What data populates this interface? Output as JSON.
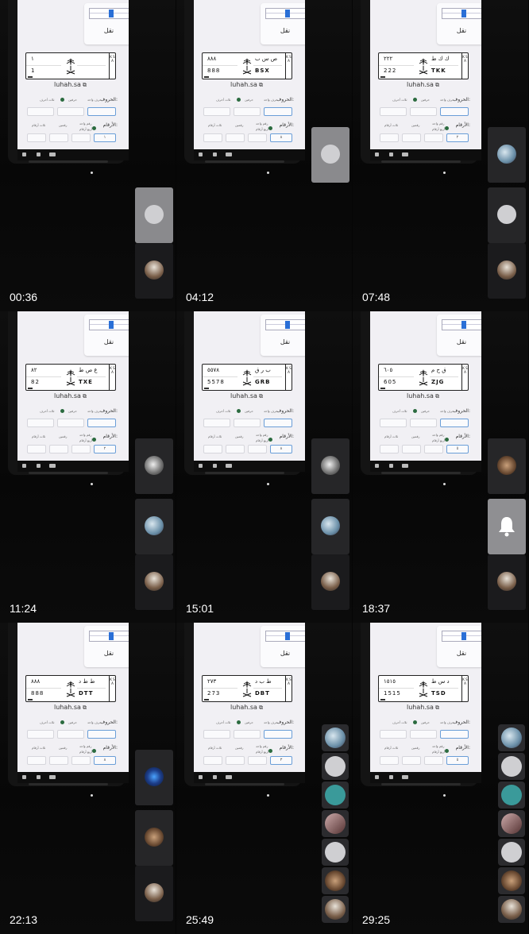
{
  "frames": [
    {
      "timestamp": "00:36",
      "plate": {
        "ar_num": "١",
        "en_num": "1",
        "ar_let": "",
        "en_let": ""
      },
      "numbers_input": "١",
      "tiles": [
        "person",
        "sheikh"
      ]
    },
    {
      "timestamp": "04:12",
      "plate": {
        "ar_num": "٨٨٨",
        "en_num": "888",
        "ar_let": "ص س ب",
        "en_let": "BSX"
      },
      "numbers_input": "٨",
      "tiles": [
        "person"
      ]
    },
    {
      "timestamp": "07:48",
      "plate": {
        "ar_num": "٢٢٢",
        "en_num": "222",
        "ar_let": "ك ك ط",
        "en_let": "TKK"
      },
      "numbers_input": "٢",
      "tiles": [
        "photo",
        "person2",
        "sheikh"
      ]
    },
    {
      "timestamp": "11:24",
      "plate": {
        "ar_num": "٨٢",
        "en_num": "82",
        "ar_let": "ع ص ط",
        "en_let": "TXE"
      },
      "numbers_input": "٢",
      "tiles": [
        "moon",
        "photo",
        "sheikh"
      ]
    },
    {
      "timestamp": "15:01",
      "plate": {
        "ar_num": "٥٥٧٨",
        "en_num": "5578",
        "ar_let": "ب ر ق",
        "en_let": "GRB"
      },
      "numbers_input": "٨",
      "tiles": [
        "moon",
        "photo",
        "sheikh"
      ]
    },
    {
      "timestamp": "18:37",
      "plate": {
        "ar_num": "٦٠٥",
        "en_num": "605",
        "ar_let": "ق ح م",
        "en_let": "ZJG"
      },
      "numbers_input": "٥",
      "tiles": [
        "brown",
        "bell",
        "sheikh"
      ]
    },
    {
      "timestamp": "22:13",
      "plate": {
        "ar_num": "٨٨٨",
        "en_num": "888",
        "ar_let": "ط ط د",
        "en_let": "DTT"
      },
      "numbers_input": "٨",
      "tiles": [
        "blue",
        "brown",
        "sheikh"
      ]
    },
    {
      "timestamp": "25:49",
      "plate": {
        "ar_num": "٢٧٣",
        "en_num": "273",
        "ar_let": "ط ب د",
        "en_let": "DBT"
      },
      "numbers_input": "٣",
      "tiles": [
        "small-stack"
      ]
    },
    {
      "timestamp": "29:25",
      "plate": {
        "ar_num": "١٥١٥",
        "en_num": "1515",
        "ar_let": "د س ط",
        "en_let": "TSD"
      },
      "numbers_input": "٥",
      "tiles": [
        "small-stack"
      ]
    }
  ],
  "ui": {
    "panel_label": "نقل",
    "site": "luhah.sa",
    "letters_label": "الحروف:",
    "numbers_label": "الأرقام:",
    "opt_one_letter": "حرف واحد",
    "opt_two_letters": "حرفين",
    "opt_three_letters": "ثلاث أحرف",
    "opt_one_number": "رقم واحد",
    "opt_two_numbers": "رقمين",
    "opt_three_numbers": "ثلاث أرقام",
    "opt_four_numbers": "أربع أرقام",
    "ksa_text": "K S A"
  },
  "colors": {
    "accent": "#2a6fd6",
    "dot": "#2b6b3f",
    "background": "#000000"
  }
}
